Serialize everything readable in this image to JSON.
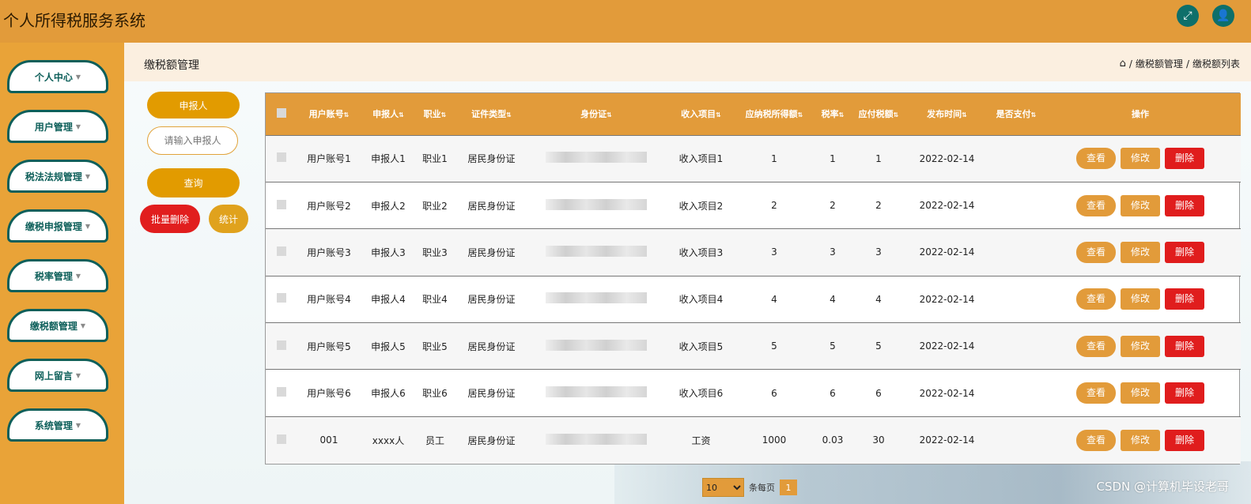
{
  "app": {
    "title": "个人所得税服务系统",
    "watermark": "CSDN @计算机毕设老哥"
  },
  "top_icons": {
    "fullscreen": "expand-icon",
    "user": "user-icon"
  },
  "sidebar": {
    "items": [
      {
        "label": "个人中心"
      },
      {
        "label": "用户管理"
      },
      {
        "label": "税法法规管理"
      },
      {
        "label": "缴税申报管理"
      },
      {
        "label": "税率管理"
      },
      {
        "label": "缴税额管理"
      },
      {
        "label": "网上留言"
      },
      {
        "label": "系统管理"
      }
    ]
  },
  "page": {
    "heading": "缴税额管理",
    "breadcrumb": [
      "缴税额管理",
      "缴税额列表"
    ]
  },
  "filters": {
    "field_label": "申报人",
    "input_placeholder": "请输入申报人",
    "query_label": "查询",
    "batch_delete_label": "批量删除",
    "stats_label": "统计"
  },
  "table": {
    "headers": [
      "用户账号",
      "申报人",
      "职业",
      "证件类型",
      "身份证",
      "收入项目",
      "应纳税所得额",
      "税率",
      "应付税额",
      "发布时间",
      "是否支付",
      "操作"
    ],
    "rows": [
      {
        "account": "用户账号1",
        "declarant": "申报人1",
        "job": "职业1",
        "id_type": "居民身份证",
        "income": "收入项目1",
        "taxable": "1",
        "rate": "1",
        "tax": "1",
        "date": "2022-02-14",
        "paid": ""
      },
      {
        "account": "用户账号2",
        "declarant": "申报人2",
        "job": "职业2",
        "id_type": "居民身份证",
        "income": "收入项目2",
        "taxable": "2",
        "rate": "2",
        "tax": "2",
        "date": "2022-02-14",
        "paid": ""
      },
      {
        "account": "用户账号3",
        "declarant": "申报人3",
        "job": "职业3",
        "id_type": "居民身份证",
        "income": "收入项目3",
        "taxable": "3",
        "rate": "3",
        "tax": "3",
        "date": "2022-02-14",
        "paid": ""
      },
      {
        "account": "用户账号4",
        "declarant": "申报人4",
        "job": "职业4",
        "id_type": "居民身份证",
        "income": "收入项目4",
        "taxable": "4",
        "rate": "4",
        "tax": "4",
        "date": "2022-02-14",
        "paid": ""
      },
      {
        "account": "用户账号5",
        "declarant": "申报人5",
        "job": "职业5",
        "id_type": "居民身份证",
        "income": "收入项目5",
        "taxable": "5",
        "rate": "5",
        "tax": "5",
        "date": "2022-02-14",
        "paid": ""
      },
      {
        "account": "用户账号6",
        "declarant": "申报人6",
        "job": "职业6",
        "id_type": "居民身份证",
        "income": "收入项目6",
        "taxable": "6",
        "rate": "6",
        "tax": "6",
        "date": "2022-02-14",
        "paid": ""
      },
      {
        "account": "001",
        "declarant": "xxxx人",
        "job": "员工",
        "id_type": "居民身份证",
        "income": "工资",
        "taxable": "1000",
        "rate": "0.03",
        "tax": "30",
        "date": "2022-02-14",
        "paid": ""
      }
    ],
    "actions": {
      "view": "查看",
      "edit": "修改",
      "delete": "删除"
    }
  },
  "pager": {
    "page_size": "10",
    "per_page_label": "条每页",
    "current_page": "1"
  },
  "colors": {
    "accent": "#e29b3a",
    "sidebar_border": "#0d5f5a",
    "danger": "#e01d1d"
  }
}
